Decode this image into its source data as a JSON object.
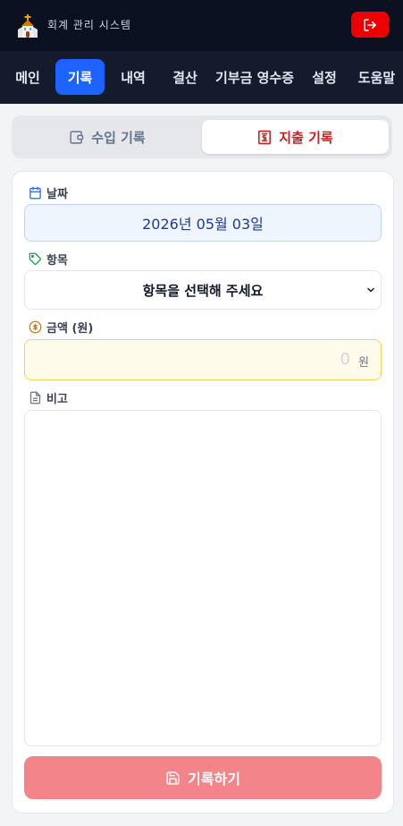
{
  "header": {
    "app_title": "회계 관리 시스템",
    "logo_icon": "church-icon",
    "logout_icon": "logout-icon"
  },
  "nav": {
    "items": [
      {
        "label": "메인"
      },
      {
        "label": "기록",
        "active": true
      },
      {
        "label": "내역"
      },
      {
        "label": "결산"
      },
      {
        "label": "기부금 영수증"
      },
      {
        "label": "설정"
      },
      {
        "label": "도움말"
      }
    ]
  },
  "record_type": {
    "income_label": "수입 기록",
    "expense_label": "지출 기록",
    "selected": "expense"
  },
  "form": {
    "date_label": "날짜",
    "date_value": "2026년 05월 03일",
    "category_label": "항목",
    "category_placeholder": "항목을 선택해 주세요",
    "amount_label": "금액 (원)",
    "amount_value": "0",
    "amount_unit": "원",
    "memo_label": "비고",
    "memo_value": "",
    "submit_label": "기록하기"
  },
  "colors": {
    "header_bg": "#0b1120",
    "nav_bg": "#141b2d",
    "nav_active": "#1d63ff",
    "logout_red": "#ef0000",
    "expense_red": "#c81e1e",
    "submit_disabled": "#f3858a"
  }
}
